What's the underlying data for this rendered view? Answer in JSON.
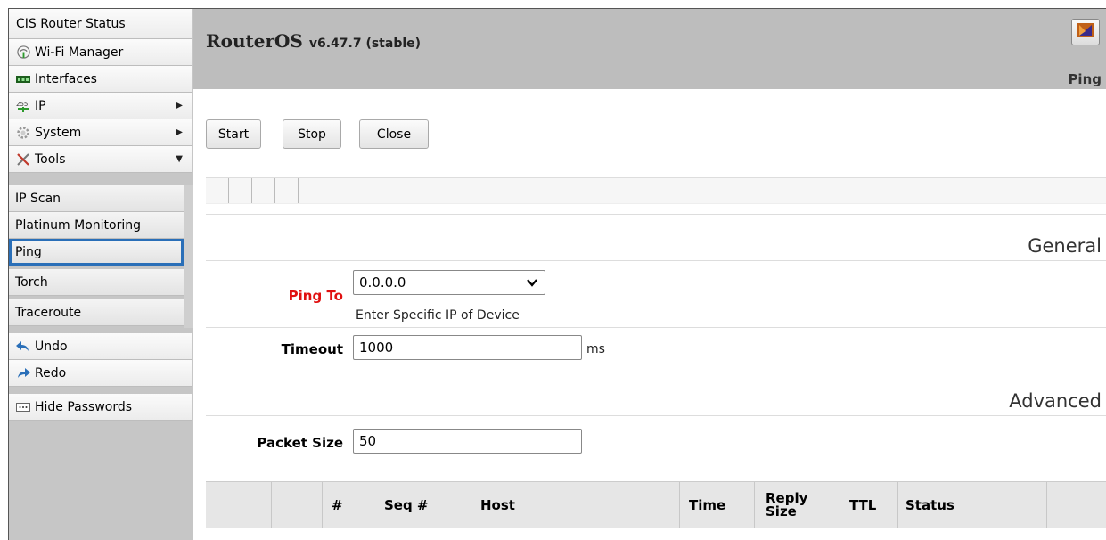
{
  "sidebar": {
    "header": "CIS Router Status",
    "items": [
      {
        "label": "Wi-Fi Manager",
        "icon": "wifi-icon"
      },
      {
        "label": "Interfaces",
        "icon": "interfaces-icon"
      },
      {
        "label": "IP",
        "icon": "ip-icon",
        "arrow": "▶"
      },
      {
        "label": "System",
        "icon": "gear-icon",
        "arrow": "▶"
      },
      {
        "label": "Tools",
        "icon": "tools-icon",
        "arrow": "▼"
      }
    ],
    "tools_sub": [
      {
        "label": "IP Scan"
      },
      {
        "label": "Platinum Monitoring"
      },
      {
        "label": "Ping",
        "active": true
      },
      {
        "label": "Torch"
      },
      {
        "label": "Traceroute"
      }
    ],
    "undo": "Undo",
    "redo": "Redo",
    "hide_passwords": "Hide Passwords"
  },
  "header": {
    "brand": "RouterOS",
    "version": "v6.47.7 (stable)",
    "page_name": "Ping"
  },
  "toolbar": {
    "start": "Start",
    "stop": "Stop",
    "close": "Close"
  },
  "general": {
    "title": "General",
    "ping_to_label": "Ping To",
    "ping_to_value": "0.0.0.0",
    "ping_to_hint": "Enter Specific IP of Device",
    "timeout_label": "Timeout",
    "timeout_value": "1000",
    "timeout_unit": "ms"
  },
  "advanced": {
    "title": "Advanced",
    "packet_size_label": "Packet Size",
    "packet_size_value": "50"
  },
  "table": {
    "columns": [
      "#",
      "Seq #",
      "Host",
      "Time",
      "Reply Size",
      "TTL",
      "Status"
    ]
  },
  "colors": {
    "required_label": "#e01010",
    "active_outline": "#2a6fb8"
  }
}
